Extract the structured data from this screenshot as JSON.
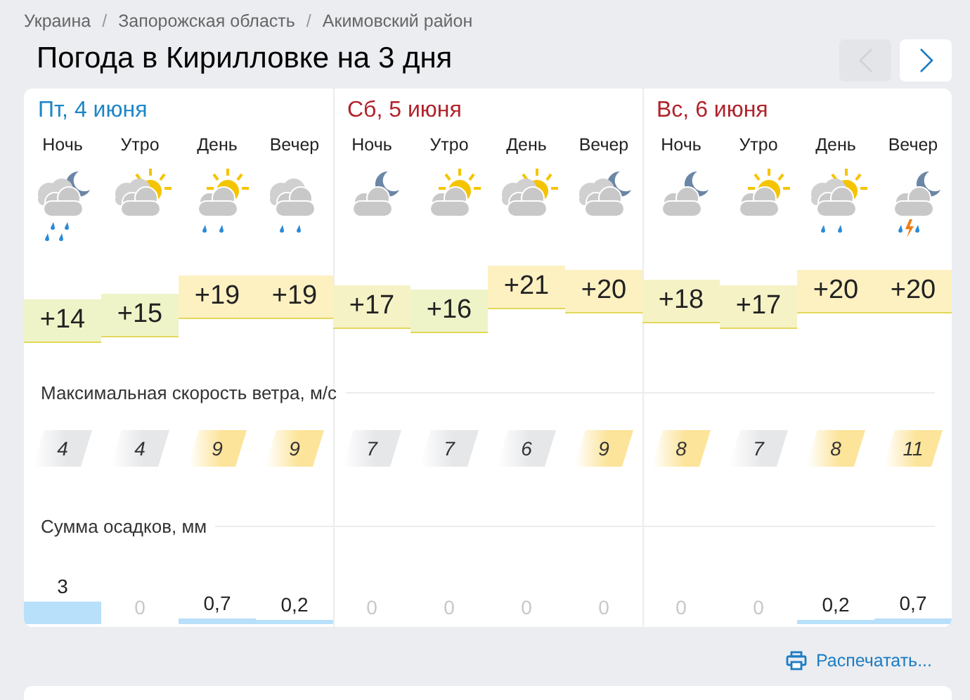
{
  "breadcrumbs": [
    {
      "label": "Украина"
    },
    {
      "separator": "/",
      "label": "Запорожская область"
    },
    {
      "separator": "/",
      "label": "Акимовский район"
    }
  ],
  "title": "Погода в Кирилловке на 3 дня",
  "nav": [
    {
      "kind": "prev",
      "disabled": true
    },
    {
      "kind": "next",
      "disabled": false
    }
  ],
  "days": [
    {
      "date": "Пт, 4 июня",
      "weekend": false,
      "periods": [
        {
          "label": "Ночь",
          "kind": "moon-clouds-heavyrain",
          "temp": "+14",
          "wind": "4",
          "wind_strong": false,
          "rain": "3"
        },
        {
          "label": "Утро",
          "kind": "sun-clouds",
          "temp": "+15",
          "wind": "4",
          "wind_strong": false,
          "rain": "0"
        },
        {
          "label": "День",
          "kind": "sun-cloud-rain",
          "temp": "+19",
          "wind": "9",
          "wind_strong": true,
          "rain": "0,7"
        },
        {
          "label": "Вечер",
          "kind": "clouds-rain",
          "temp": "+19",
          "wind": "9",
          "wind_strong": true,
          "rain": "0,2"
        }
      ]
    },
    {
      "date": "Сб, 5 июня",
      "weekend": true,
      "periods": [
        {
          "label": "Ночь",
          "kind": "moon-cloud",
          "temp": "+17",
          "wind": "7",
          "wind_strong": false,
          "rain": "0"
        },
        {
          "label": "Утро",
          "kind": "sun-cloud",
          "temp": "+16",
          "wind": "7",
          "wind_strong": false,
          "rain": "0"
        },
        {
          "label": "День",
          "kind": "sun-clouds",
          "temp": "+21",
          "wind": "6",
          "wind_strong": false,
          "rain": "0"
        },
        {
          "label": "Вечер",
          "kind": "moon-clouds",
          "temp": "+20",
          "wind": "9",
          "wind_strong": true,
          "rain": "0"
        }
      ]
    },
    {
      "date": "Вс, 6 июня",
      "weekend": true,
      "periods": [
        {
          "label": "Ночь",
          "kind": "moon-cloud",
          "temp": "+18",
          "wind": "8",
          "wind_strong": true,
          "rain": "0"
        },
        {
          "label": "Утро",
          "kind": "sun-cloud",
          "temp": "+17",
          "wind": "7",
          "wind_strong": false,
          "rain": "0"
        },
        {
          "label": "День",
          "kind": "sun-clouds-rain",
          "temp": "+20",
          "wind": "8",
          "wind_strong": true,
          "rain": "0,2"
        },
        {
          "label": "Вечер",
          "kind": "moon-cloud-thunder",
          "temp": "+20",
          "wind": "11",
          "wind_strong": true,
          "rain": "0,7"
        }
      ]
    }
  ],
  "wind_label": "Максимальная скорость ветра, м/с",
  "rain_label": "Сумма осадков, мм",
  "print_link": "Распечатать..."
}
